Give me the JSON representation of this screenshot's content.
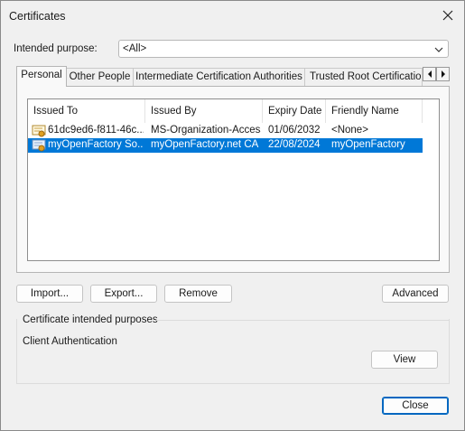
{
  "window": {
    "title": "Certificates"
  },
  "purpose": {
    "label": "Intended purpose:",
    "value": "<All>"
  },
  "tabs": [
    {
      "label": "Personal"
    },
    {
      "label": "Other People"
    },
    {
      "label": "Intermediate Certification Authorities"
    },
    {
      "label": "Trusted Root Certification Authorities"
    }
  ],
  "columns": [
    "Issued To",
    "Issued By",
    "Expiry Date",
    "Friendly Name"
  ],
  "rows": [
    {
      "issued_to": "61dc9ed6-f811-46c...",
      "issued_by": "MS-Organization-Access",
      "expiry": "01/06/2032",
      "friendly": "<None>",
      "selected": false
    },
    {
      "issued_to": "myOpenFactory So...",
      "issued_by": "myOpenFactory.net CA",
      "expiry": "22/08/2024",
      "friendly": "myOpenFactory",
      "selected": true
    }
  ],
  "buttons": {
    "import": "Import...",
    "export": "Export...",
    "remove": "Remove",
    "advanced": "Advanced",
    "view": "View",
    "close": "Close"
  },
  "purposes_group": {
    "title": "Certificate intended purposes",
    "value": "Client Authentication"
  },
  "colors": {
    "selection": "#0078d7",
    "default_button_border": "#0067c0"
  }
}
